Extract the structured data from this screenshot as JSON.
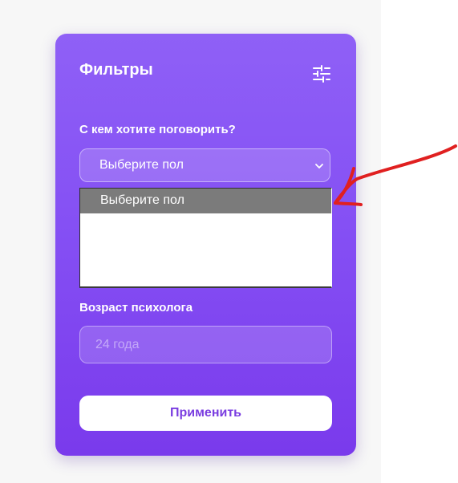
{
  "filters": {
    "title": "Фильтры",
    "gender_label": "С кем хотите поговорить?",
    "gender_select_value": "Выберите пол",
    "dropdown_options": [
      "Выберите пол"
    ],
    "age_label": "Возраст психолога",
    "age_placeholder": "24 года",
    "apply_label": "Применить"
  },
  "icons": {
    "filter": "sliders-icon",
    "select_chevron": "chevron-down-icon",
    "annotation": "red-arrow"
  },
  "colors": {
    "card_gradient_top": "#8f60f6",
    "card_gradient_bottom": "#7a3aec",
    "apply_text": "#7a3de0",
    "option_highlight": "#7b7b7b",
    "annotation_arrow": "#e02020"
  }
}
